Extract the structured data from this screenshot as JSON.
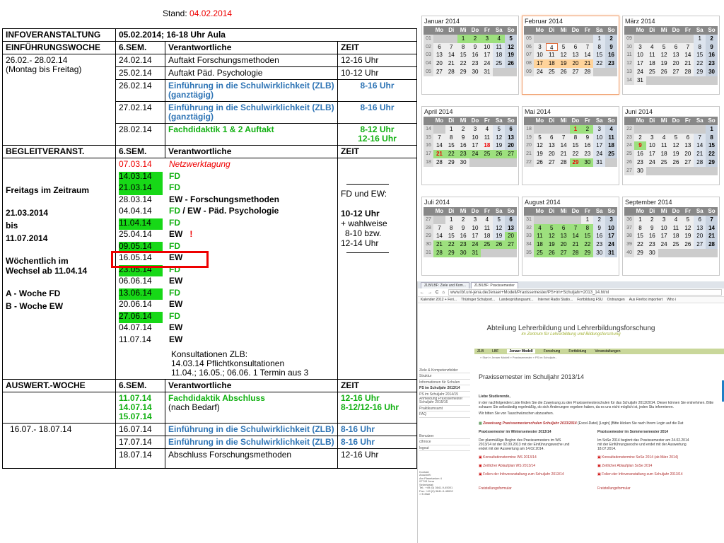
{
  "stand": {
    "label": "Stand:",
    "date": "04.02.2014"
  },
  "schedule": {
    "infoveranstaltung": {
      "label": "INFOVERANSTALTUNG",
      "value": "05.02.2014;  16-18 Uhr Aula"
    },
    "einfuehrung": {
      "headers": [
        "EINFÜHRUNGSWOCHE",
        "6.SEM.",
        "Verantwortliche",
        "ZEIT"
      ],
      "period": "26.02.- 28.02.14",
      "period_note": "(Montag bis Freitag)",
      "rows": [
        {
          "date": "24.02.14",
          "text": "Auftakt Forschungsmethoden",
          "time": "12-16 Uhr",
          "style": "plain"
        },
        {
          "date": "25.02.14",
          "text": "Auftakt Päd. Psychologie",
          "time": "10-12 Uhr",
          "style": "plain"
        },
        {
          "date": "26.02.14",
          "text": "Einführung in die Schulwirklichkeit (ZLB) (ganztägig)",
          "time": "8-16 Uhr",
          "style": "blue"
        },
        {
          "date": "27.02.14",
          "text": "Einführung in die Schulwirklichkeit (ZLB) (ganztägig)",
          "time": "8-16 Uhr",
          "style": "blue"
        },
        {
          "date": "28.02.14",
          "text": "Fachdidaktik  1 & 2 Auftakt",
          "time": "8-12 Uhr\n12-16 Uhr",
          "style": "green"
        }
      ]
    },
    "begleit": {
      "headers": [
        "BEGLEITVERANST.",
        "6.SEM.",
        "Verantwortliche",
        "ZEIT"
      ],
      "left_text": [
        "Freitags  im Zeitraum",
        "21.03.2014",
        "bis",
        "11.07.2014",
        "Wöchentlich  im",
        "Wechsel  ab 11.04.14",
        "A - Woche   FD",
        "B - Woche   EW"
      ],
      "dates": [
        {
          "date": "07.03.14",
          "text": "Netzwerktagung",
          "dstyle": "red",
          "tstyle": "redit"
        },
        {
          "date": "14.03.14",
          "text": "FD",
          "dstyle": "gbg",
          "tstyle": "green"
        },
        {
          "date": "21.03.14",
          "text": "FD",
          "dstyle": "gbg",
          "tstyle": "green"
        },
        {
          "date": "28.03.14",
          "text": "EW - Forschungsmethoden",
          "dstyle": "",
          "tstyle": "b"
        },
        {
          "date": "04.04.14",
          "text": "FD / EW - Päd. Psychologie",
          "dstyle": "",
          "tstyle": "mixed"
        },
        {
          "date": "11.04.14",
          "text": "FD",
          "dstyle": "gbg",
          "tstyle": "green"
        },
        {
          "date": "25.04.14",
          "text": "EW",
          "dstyle": "",
          "tstyle": "b",
          "mark": "!"
        },
        {
          "date": "09.05.14",
          "text": "FD",
          "dstyle": "gbg",
          "tstyle": "green"
        },
        {
          "date": "16.05.14",
          "text": "EW",
          "dstyle": "",
          "tstyle": "b"
        },
        {
          "date": "23.05.14",
          "text": "FD",
          "dstyle": "gbg",
          "tstyle": "green"
        },
        {
          "date": "06.06.14",
          "text": "EW",
          "dstyle": "",
          "tstyle": "b"
        },
        {
          "date": "13.06.14",
          "text": "FD",
          "dstyle": "gbg",
          "tstyle": "green"
        },
        {
          "date": "20.06.14",
          "text": "EW",
          "dstyle": "",
          "tstyle": "b"
        },
        {
          "date": "27.06.14",
          "text": "FD",
          "dstyle": "gbg",
          "tstyle": "green"
        },
        {
          "date": "04.07.14",
          "text": "EW",
          "dstyle": "",
          "tstyle": "b"
        },
        {
          "date": "11.07.14",
          "text": "EW",
          "dstyle": "",
          "tstyle": "b"
        }
      ],
      "fd_ew_label": "FD und EW:",
      "time_lines": [
        "10-12 Uhr",
        "+ wahlweise",
        "8-10  bzw.",
        "12-14  Uhr"
      ],
      "konsult_title": "Konsultationen ZLB:",
      "konsult_lines": [
        "14.03.14  Pflichtkonsultationen",
        "11.04.; 16.05.; 06.06.  1 Termin  aus 3"
      ]
    },
    "auswert": {
      "headers": [
        "AUSWERT.-WOCHE",
        "6.SEM.",
        "Verantwortliche",
        "ZEIT"
      ],
      "rows": [
        {
          "dates": "11.07.14\n14.07.14\n15.07.14",
          "text": "Fachdidaktik  Abschluss",
          "text2": "(nach Bedarf)",
          "time": "12-16  Uhr\n8-12/12-16  Uhr",
          "style": "green"
        },
        {
          "period": "16.07.- 18.07.14",
          "date": "16.07.14",
          "text": "Einführung in die Schulwirklichkeit (ZLB)",
          "time": "8-16 Uhr",
          "style": "blue"
        },
        {
          "date": "17.07.14",
          "text": "Einführung in die Schulwirklichkeit (ZLB)",
          "time": "8-16 Uhr",
          "style": "blue"
        },
        {
          "date": "18.07.14",
          "text": "Abschluss Forschungsmethoden",
          "time": "12-16 Uhr",
          "style": "plain"
        }
      ]
    }
  },
  "calendar": {
    "day_headers": [
      "Mo",
      "Di",
      "Mi",
      "Do",
      "Fr",
      "Sa",
      "So"
    ],
    "months": [
      {
        "name": "Januar 2014",
        "start": 2,
        "days": 31,
        "week": 1
      },
      {
        "name": "Februar 2014",
        "start": 5,
        "days": 28,
        "week": 5,
        "current": true
      },
      {
        "name": "März 2014",
        "start": 5,
        "days": 31,
        "week": 9
      },
      {
        "name": "April 2014",
        "start": 1,
        "days": 30,
        "week": 14
      },
      {
        "name": "Mai 2014",
        "start": 3,
        "days": 31,
        "week": 18
      },
      {
        "name": "Juni 2014",
        "start": 6,
        "days": 30,
        "week": 22
      },
      {
        "name": "Juli 2014",
        "start": 1,
        "days": 31,
        "week": 27
      },
      {
        "name": "August 2014",
        "start": 4,
        "days": 31,
        "week": 31
      },
      {
        "name": "September 2014",
        "start": 0,
        "days": 30,
        "week": 36
      }
    ]
  },
  "browser": {
    "tabs": [
      "ZLB/LBF: Ziele und Kom...",
      "ZLB/LBF: Praxissemester"
    ],
    "url": "www.lbf.uni-jena.de/Jenaer+Modell/Praxissemester/PS+im+Schuljahr+2013_14.html",
    "bookmarks": [
      "Kalender 2012 + Feri...",
      "Thüringer Schulport...",
      "Landesprüfungsamt...",
      "Internet Radio Statio...",
      "Fortbildung FSU",
      "Ordnungen",
      "Aus Firefox importiert",
      "Who i"
    ],
    "site_title": "Abteilung Lehrerbildung und Lehrerbildungsforschung",
    "site_subtitle": "im Zentrum für Lehrerbildung und Bildungsforschung",
    "menu": [
      "ZLB",
      "LBF",
      "Jenaer Modell",
      "Forschung",
      "Fortbildung",
      "Veranstaltungen"
    ],
    "breadcrumb": "» Start » Jenaer Modell » Praxissemester » PS im Schuljahr...",
    "side": [
      "Ziele & Kompetenzfelder",
      "Struktur",
      "Informationen für Schulen",
      "PS im Schuljahr 2013/14",
      "PS im Schuljahr 2014/15",
      "Anmeldung Praxissemester Schuljahr 2015/16",
      "Praktikumsamt",
      "FAQ"
    ],
    "side_user": [
      "Benutzer:",
      "cthroce",
      "logout"
    ],
    "kontakt": "Kontakt\nAnschrift:\nAm Planetarium 4\n07743 Jena\nSekretariat:\nTel.: +49 (0) 3641-9-45001\nFax: +49 (0) 3641-9-45002\n> E-Mail",
    "page_title": "Praxissemester im Schuljahr 2013/14",
    "greeting": "Liebe Studierende,",
    "p1": "in der nachfolgenden Liste finden Sie die Zuweisung zu den Praxissemesterschulen für das Schuljahr 2013/2014. Dieser können Sie entnehmen. Bitte schauen Sie selbständig regelmäßig, ob sich Änderungen ergeben haben, da es uns nicht möglich ist, jeden Stu informieren.",
    "p2": "Wir bitten Sie von Tauschwünschen abzusehen.",
    "zuweisung": "Zuweisung Praxissemesterschulen Schuljahr 2013/2014",
    "zuweisung_tail": "(Excel-Datei) [Login] (Bitte klicken Sie nach Ihrem Login auf die Dat",
    "ws_title": "Praxissemester im Wintersemester 2013/14",
    "ws_text": "Der planmäßige Beginn des Praxissemesters im WS 2013/14 ist der 02.09.2013 mit der Einführungswoche und endet mit der Auswertung am 14.02.2014.",
    "ws_links": [
      "Konsultationstermine WS 2013/14",
      "Zeitlicher Ablaufplan WS 2013/14",
      "Folien der Infoveranstaltung zum Schuljahr 2013/14"
    ],
    "ss_title": "Praxissemester im Sommersemester 2014",
    "ss_text": "Im SoSe 2014 beginnt das Praxissemester am 24.02.2014 mit der Einführungswoche und endet mit der Auswertung 18.07.2014.",
    "ss_links": [
      "Konsultationstermine SoSe 2014 (ab März 2014)",
      "Zeitlicher Ablaufplan SoSe 2014",
      "Folien der Infoveranstaltung zum Schuljahr 2013/14"
    ],
    "form_ws": "Freistellungsformular",
    "form_ss": "Freistellungsformular"
  }
}
